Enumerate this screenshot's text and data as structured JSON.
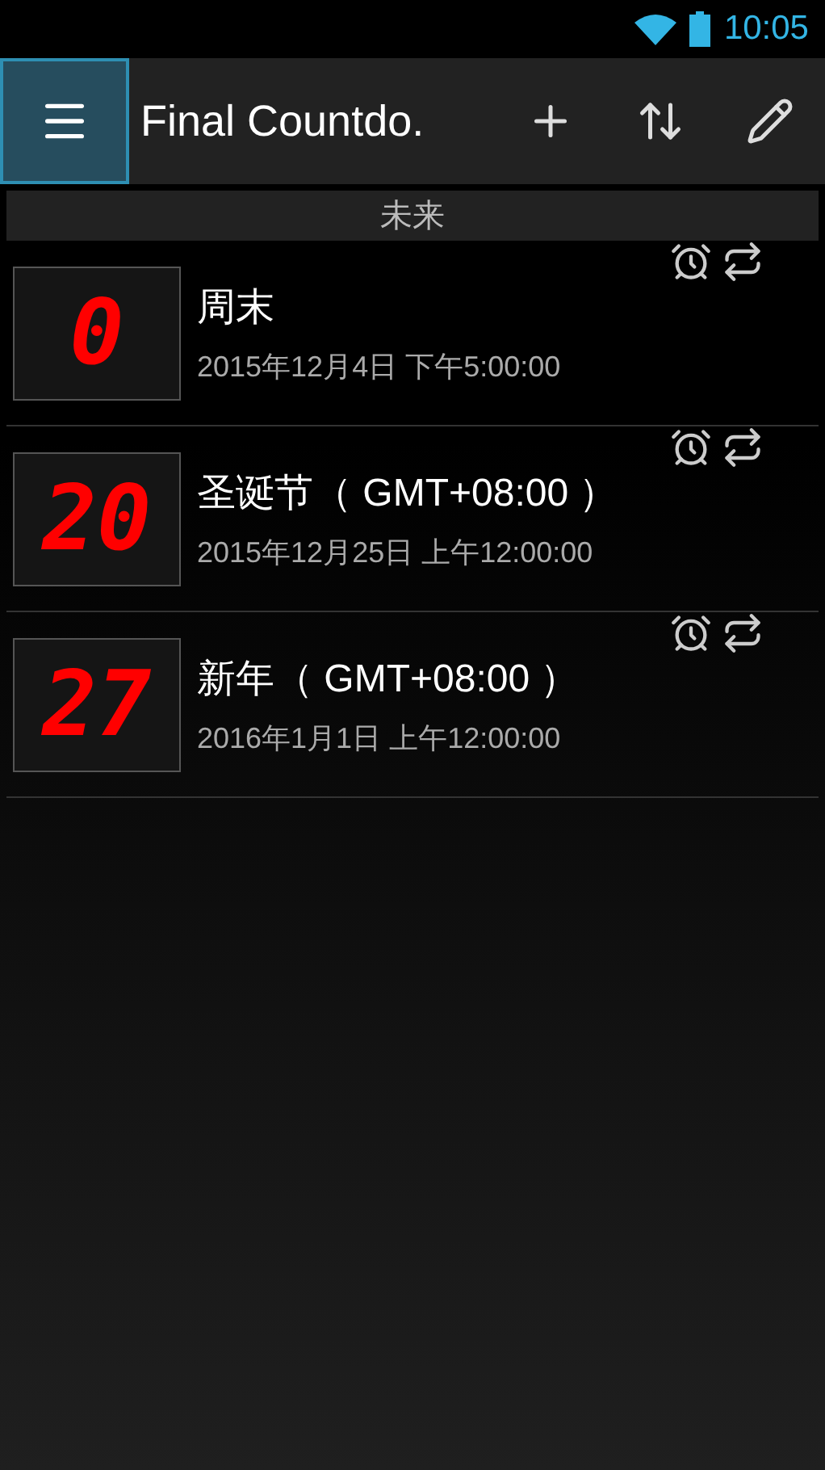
{
  "status_bar": {
    "time": "10:05"
  },
  "action_bar": {
    "title": "Final Countdo.",
    "actions": [
      {
        "kind": "add"
      },
      {
        "kind": "sort"
      },
      {
        "kind": "edit"
      }
    ]
  },
  "section": {
    "title": "未来"
  },
  "events": [
    {
      "days": "0",
      "title": "周末",
      "date": "2015年12月4日 下午5:00:00",
      "alarm": true,
      "repeat": true
    },
    {
      "days": "20",
      "title": "圣诞节（ GMT+08:00 ）",
      "date": "2015年12月25日 上午12:00:00",
      "alarm": true,
      "repeat": true
    },
    {
      "days": "27",
      "title": "新年（ GMT+08:00 ）",
      "date": "2016年1月1日 上午12:00:00",
      "alarm": true,
      "repeat": true
    }
  ]
}
